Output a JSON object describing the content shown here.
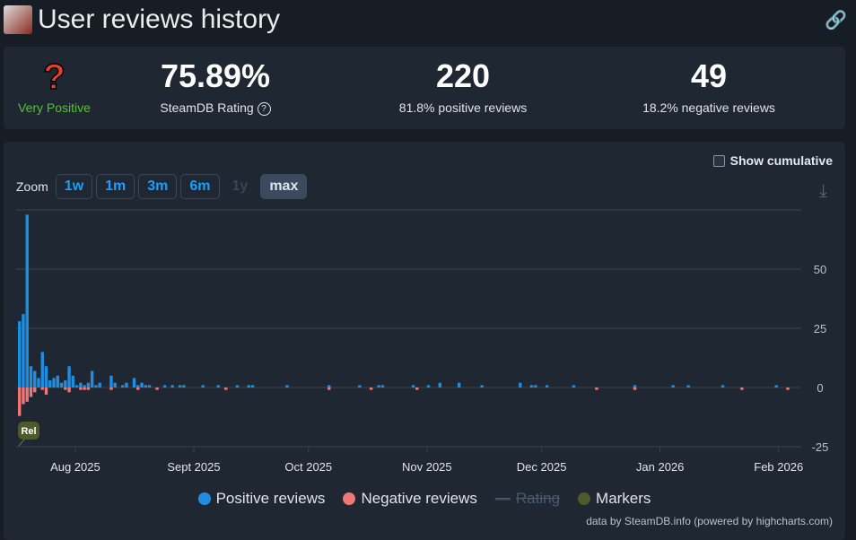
{
  "header": {
    "title": "User reviews history"
  },
  "stats": {
    "verdict": "Very Positive",
    "verdict_icon": "?",
    "rating": "75.89%",
    "rating_label": "SteamDB Rating",
    "positive": "220",
    "positive_label": "81.8% positive reviews",
    "negative": "49",
    "negative_label": "18.2% negative reviews"
  },
  "controls": {
    "show_cumulative": "Show cumulative",
    "zoom_label": "Zoom",
    "zoom_buttons": [
      "1w",
      "1m",
      "3m",
      "6m",
      "1y",
      "max"
    ]
  },
  "legend": {
    "positive": "Positive reviews",
    "negative": "Negative reviews",
    "rating": "Rating",
    "markers": "Markers"
  },
  "credit": "data by SteamDB.info (powered by highcharts.com)",
  "marker": "Rel",
  "colors": {
    "positive": "#1f8ee0",
    "negative": "#ef7777",
    "marker": "#4e5a2a"
  },
  "chart_data": {
    "type": "bar",
    "start_date": "2025-07-17",
    "x_tick_labels": [
      "Aug 2025",
      "Sept 2025",
      "Oct 2025",
      "Nov 2025",
      "Dec 2025",
      "Jan 2026",
      "Feb 2026"
    ],
    "x_tick_days": [
      15,
      46,
      76,
      107,
      137,
      168,
      199
    ],
    "y_ticks": [
      -25,
      0,
      25,
      50
    ],
    "ylim": [
      -25,
      75
    ],
    "series": [
      {
        "name": "Positive reviews",
        "color": "#1f8ee0"
      },
      {
        "name": "Negative reviews",
        "color": "#ef7777"
      }
    ],
    "points": [
      [
        0,
        28,
        12
      ],
      [
        1,
        31,
        7
      ],
      [
        2,
        73,
        6
      ],
      [
        3,
        9,
        4
      ],
      [
        4,
        7,
        2
      ],
      [
        5,
        4,
        0
      ],
      [
        6,
        15,
        1
      ],
      [
        7,
        9,
        3
      ],
      [
        8,
        3,
        0
      ],
      [
        9,
        4,
        0
      ],
      [
        10,
        5,
        0
      ],
      [
        11,
        2,
        0
      ],
      [
        12,
        3,
        1
      ],
      [
        13,
        9,
        2
      ],
      [
        14,
        5,
        0
      ],
      [
        15,
        1,
        0
      ],
      [
        16,
        2,
        1
      ],
      [
        17,
        1,
        1
      ],
      [
        18,
        2,
        1
      ],
      [
        19,
        7,
        0
      ],
      [
        20,
        1,
        0
      ],
      [
        21,
        2,
        0
      ],
      [
        24,
        5,
        1
      ],
      [
        25,
        2,
        0
      ],
      [
        27,
        1,
        0
      ],
      [
        28,
        2,
        0
      ],
      [
        30,
        4,
        0
      ],
      [
        31,
        1,
        1
      ],
      [
        32,
        2,
        0
      ],
      [
        33,
        1,
        0
      ],
      [
        34,
        1,
        0
      ],
      [
        36,
        0,
        1
      ],
      [
        38,
        1,
        0
      ],
      [
        40,
        1,
        0
      ],
      [
        42,
        1,
        0
      ],
      [
        43,
        1,
        0
      ],
      [
        48,
        1,
        0
      ],
      [
        52,
        1,
        0
      ],
      [
        54,
        0,
        1
      ],
      [
        57,
        1,
        0
      ],
      [
        60,
        1,
        0
      ],
      [
        61,
        1,
        0
      ],
      [
        70,
        1,
        0
      ],
      [
        81,
        1,
        1
      ],
      [
        89,
        1,
        0
      ],
      [
        92,
        0,
        1
      ],
      [
        94,
        1,
        0
      ],
      [
        95,
        1,
        0
      ],
      [
        103,
        1,
        0
      ],
      [
        104,
        0,
        1
      ],
      [
        107,
        1,
        0
      ],
      [
        110,
        2,
        0
      ],
      [
        115,
        2,
        0
      ],
      [
        121,
        1,
        0
      ],
      [
        131,
        2,
        0
      ],
      [
        134,
        1,
        0
      ],
      [
        135,
        1,
        0
      ],
      [
        138,
        1,
        0
      ],
      [
        145,
        1,
        0
      ],
      [
        151,
        0,
        1
      ],
      [
        161,
        1,
        1
      ],
      [
        171,
        1,
        0
      ],
      [
        175,
        1,
        0
      ],
      [
        184,
        1,
        0
      ],
      [
        189,
        0,
        1
      ],
      [
        198,
        1,
        0
      ],
      [
        201,
        0,
        1
      ]
    ]
  }
}
